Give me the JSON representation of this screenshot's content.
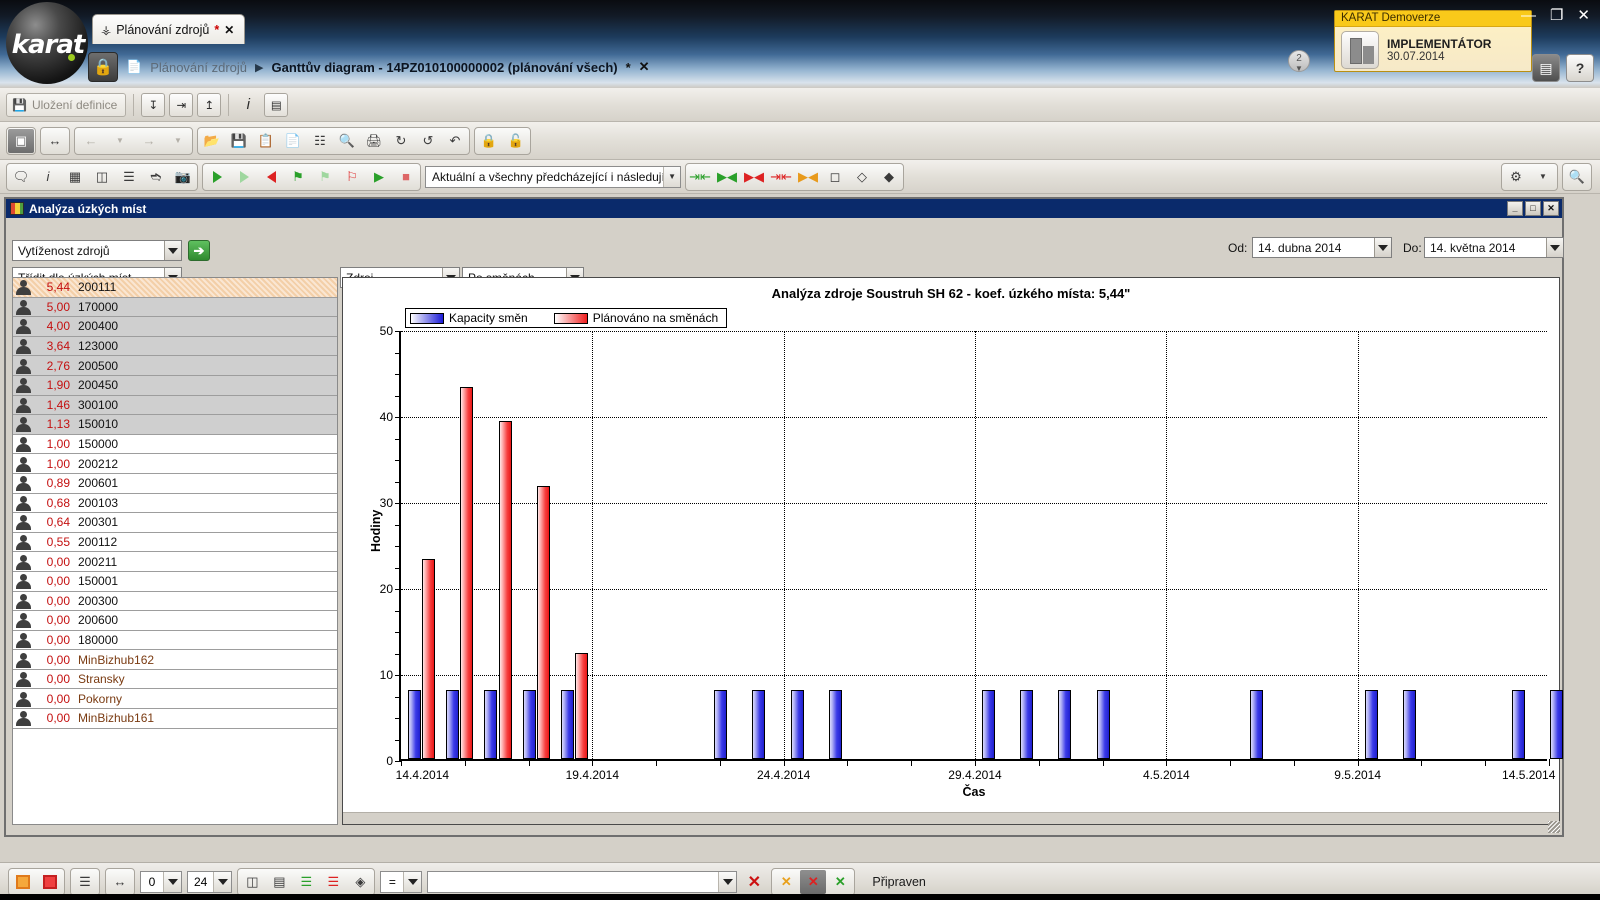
{
  "app": {
    "logo_text": "karat",
    "tab": {
      "label": "Plánování zdrojů",
      "modified_marker": "*",
      "close": "✕",
      "icon": "plug-icon"
    },
    "breadcrumb": {
      "root": "Plánování zdrojů",
      "separator": "▶",
      "current": "Ganttův diagram - 14PZ010100000002 (plánování všech)",
      "modified_marker": "*",
      "close": "✕"
    },
    "license": {
      "title": "KARAT Demoverze",
      "role": "IMPLEMENTÁTOR",
      "date": "30.07.2014"
    },
    "notifications": "2",
    "window_controls": {
      "minimize": "—",
      "restore": "❐",
      "close": "✕"
    },
    "header_buttons": {
      "window": "▤",
      "help": "?"
    }
  },
  "toolbar_top": {
    "save_definition": "Uložení definice",
    "buttons": [
      "import-icon",
      "export-icon",
      "upload-icon",
      "info-icon",
      "settings-table-icon"
    ]
  },
  "toolbar_main": {
    "view_buttons": [
      "layout-icon",
      "fit-icon"
    ],
    "nav": {
      "back": "←",
      "back_menu": "▾",
      "forward": "→",
      "forward_menu": "▾"
    },
    "file_group": [
      "open-icon",
      "save-icon",
      "copy-icon",
      "paste-icon",
      "frame-icon",
      "preview-icon",
      "print-icon",
      "refresh-icon",
      "recalc-icon",
      "revert-icon"
    ],
    "lock_group": [
      "lock-icon",
      "unlock-icon"
    ]
  },
  "toolbar_second": {
    "left_group": [
      "comment-icon",
      "info-icon",
      "grid-icon",
      "table-settings-icon",
      "list-settings-icon",
      "link-settings-icon",
      "camera-icon"
    ],
    "play_group": [
      "play-green-icon",
      "play-outline-icon",
      "play-left-red-icon",
      "flag-green-icon",
      "flag-outline-icon",
      "flag-red-icon",
      "play-list-icon",
      "stop-icon"
    ],
    "mode_select": "Aktuální a všechny předcházející i následující",
    "align_group": [
      "align-both-green-icon",
      "align-right-green-icon",
      "align-left-red-icon",
      "align-both-red-icon",
      "align-orange-icon",
      "box-icon",
      "diamond-icon",
      "diamond-filled-icon"
    ],
    "right_group": [
      "gear-icon",
      "gear-menu-icon",
      "search-icon"
    ]
  },
  "analysis_window": {
    "title": "Analýza úzkých míst",
    "window_buttons": {
      "minimize": "_",
      "maximize": "□",
      "close": "✕"
    },
    "analysis_type": "Vytíženost zdrojů",
    "go_button": "➔",
    "sort_by": "Třídit dle úzkých míst",
    "source_select": "Zdroj",
    "grouping_select": "Po směnách",
    "date_from": {
      "label": "Od:",
      "value": "14.  dubna  2014"
    },
    "date_to": {
      "label": "Do:",
      "value": "14.  května  2014"
    }
  },
  "resource_list": [
    {
      "coef": "5,44",
      "code": "200111",
      "selected": true,
      "shade": false,
      "is_name": false
    },
    {
      "coef": "5,00",
      "code": "170000",
      "selected": false,
      "shade": true,
      "is_name": false
    },
    {
      "coef": "4,00",
      "code": "200400",
      "selected": false,
      "shade": true,
      "is_name": false
    },
    {
      "coef": "3,64",
      "code": "123000",
      "selected": false,
      "shade": true,
      "is_name": false
    },
    {
      "coef": "2,76",
      "code": "200500",
      "selected": false,
      "shade": true,
      "is_name": false
    },
    {
      "coef": "1,90",
      "code": "200450",
      "selected": false,
      "shade": true,
      "is_name": false
    },
    {
      "coef": "1,46",
      "code": "300100",
      "selected": false,
      "shade": true,
      "is_name": false
    },
    {
      "coef": "1,13",
      "code": "150010",
      "selected": false,
      "shade": true,
      "is_name": false
    },
    {
      "coef": "1,00",
      "code": "150000",
      "selected": false,
      "shade": false,
      "is_name": false
    },
    {
      "coef": "1,00",
      "code": "200212",
      "selected": false,
      "shade": false,
      "is_name": false
    },
    {
      "coef": "0,89",
      "code": "200601",
      "selected": false,
      "shade": false,
      "is_name": false
    },
    {
      "coef": "0,68",
      "code": "200103",
      "selected": false,
      "shade": false,
      "is_name": false
    },
    {
      "coef": "0,64",
      "code": "200301",
      "selected": false,
      "shade": false,
      "is_name": false
    },
    {
      "coef": "0,55",
      "code": "200112",
      "selected": false,
      "shade": false,
      "is_name": false
    },
    {
      "coef": "0,00",
      "code": "200211",
      "selected": false,
      "shade": false,
      "is_name": false
    },
    {
      "coef": "0,00",
      "code": "150001",
      "selected": false,
      "shade": false,
      "is_name": false
    },
    {
      "coef": "0,00",
      "code": "200300",
      "selected": false,
      "shade": false,
      "is_name": false
    },
    {
      "coef": "0,00",
      "code": "200600",
      "selected": false,
      "shade": false,
      "is_name": false
    },
    {
      "coef": "0,00",
      "code": "180000",
      "selected": false,
      "shade": false,
      "is_name": false
    },
    {
      "coef": "0,00",
      "code": "MinBizhub162",
      "selected": false,
      "shade": false,
      "is_name": true
    },
    {
      "coef": "0,00",
      "code": "Stransky",
      "selected": false,
      "shade": false,
      "is_name": true
    },
    {
      "coef": "0,00",
      "code": "Pokorny",
      "selected": false,
      "shade": false,
      "is_name": true
    },
    {
      "coef": "0,00",
      "code": "MinBizhub161",
      "selected": false,
      "shade": false,
      "is_name": true
    }
  ],
  "chart_data": {
    "type": "bar",
    "title": "Analýza zdroje Soustruh SH 62 - koef. úzkého místa: 5,44\"",
    "xlabel": "Čas",
    "ylabel": "Hodiny",
    "ylim": [
      0,
      50
    ],
    "yticks": [
      0,
      10,
      20,
      30,
      40,
      50
    ],
    "x_tick_labels": [
      "14.4.2014",
      "19.4.2014",
      "24.4.2014",
      "29.4.2014",
      "4.5.2014",
      "9.5.2014",
      "14.5.2014"
    ],
    "x_range_days": [
      0,
      30
    ],
    "grid": "horizontal-dotted-and-vertical-dotted",
    "legend_position": "top-left",
    "colors": {
      "capacity": "#2020cf",
      "planned": "#ea1717"
    },
    "series": [
      {
        "name": "Kapacity směn",
        "color": "#2020cf",
        "points": [
          {
            "day": 0.35,
            "value": 8
          },
          {
            "day": 1.35,
            "value": 8
          },
          {
            "day": 2.35,
            "value": 8
          },
          {
            "day": 3.35,
            "value": 8
          },
          {
            "day": 4.35,
            "value": 8
          },
          {
            "day": 8.35,
            "value": 8
          },
          {
            "day": 9.35,
            "value": 8
          },
          {
            "day": 10.35,
            "value": 8
          },
          {
            "day": 11.35,
            "value": 8
          },
          {
            "day": 15.35,
            "value": 8
          },
          {
            "day": 16.35,
            "value": 8
          },
          {
            "day": 17.35,
            "value": 8
          },
          {
            "day": 18.35,
            "value": 8
          },
          {
            "day": 22.35,
            "value": 8
          },
          {
            "day": 25.35,
            "value": 8
          },
          {
            "day": 26.35,
            "value": 8
          },
          {
            "day": 29.2,
            "value": 8
          },
          {
            "day": 30.2,
            "value": 8
          }
        ]
      },
      {
        "name": "Plánováno na směnách",
        "color": "#ea1717",
        "points": [
          {
            "day": 0.72,
            "value": 23.2
          },
          {
            "day": 1.72,
            "value": 43.2
          },
          {
            "day": 2.72,
            "value": 39.3
          },
          {
            "day": 3.72,
            "value": 31.8
          },
          {
            "day": 4.72,
            "value": 12.3
          }
        ]
      }
    ]
  },
  "status_bar": {
    "icons_left": [
      "stop-orange-icon",
      "stop-red-icon",
      "columns-icon",
      "width-icon"
    ],
    "zoom_from": "0",
    "zoom_to": "24",
    "view_icons": [
      "rows-split-icon",
      "rows-stack-icon",
      "bars-green-icon",
      "bars-red-icon",
      "marker-icon"
    ],
    "filter_operator": "=",
    "filter_value": "",
    "clear_filter": "✕",
    "filter_icons": [
      "filter-orange-icon",
      "filter-red-icon",
      "filter-green-icon"
    ],
    "status_text": "Připraven"
  }
}
